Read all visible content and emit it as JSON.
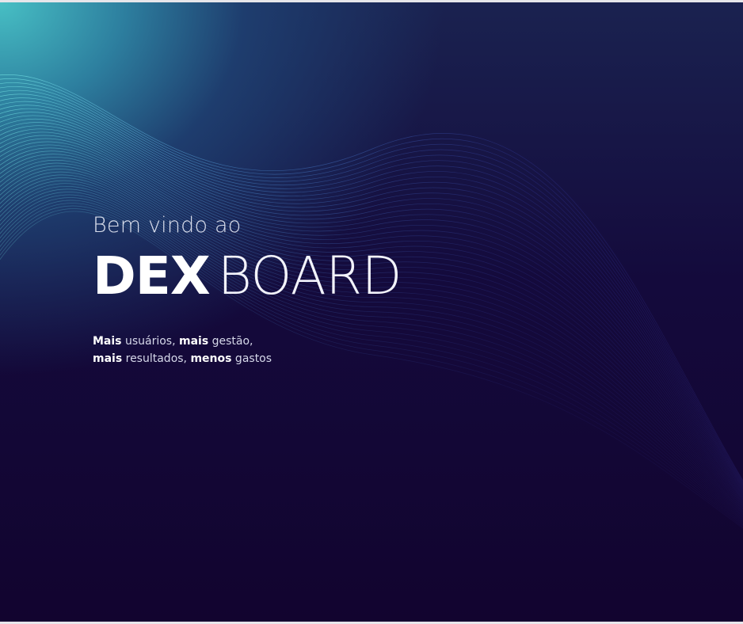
{
  "hero": {
    "welcome": "Bem vindo ao",
    "title_strong": "DEX",
    "title_light": "BOARD",
    "tagline": {
      "line1": [
        {
          "text": "Mais",
          "bold": true
        },
        {
          "text": " usuários, ",
          "bold": false
        },
        {
          "text": "mais",
          "bold": true
        },
        {
          "text": " gestão,",
          "bold": false
        }
      ],
      "line2": [
        {
          "text": "mais",
          "bold": true
        },
        {
          "text": " resultados, ",
          "bold": false
        },
        {
          "text": "menos",
          "bold": true
        },
        {
          "text": " gastos",
          "bold": false
        }
      ]
    }
  },
  "colors": {
    "background_dark": "#130534",
    "accent_teal": "#47bfc4",
    "wave_teal": "#5fd0d2",
    "wave_blue": "#4a5fd6",
    "text": "#ffffff"
  }
}
